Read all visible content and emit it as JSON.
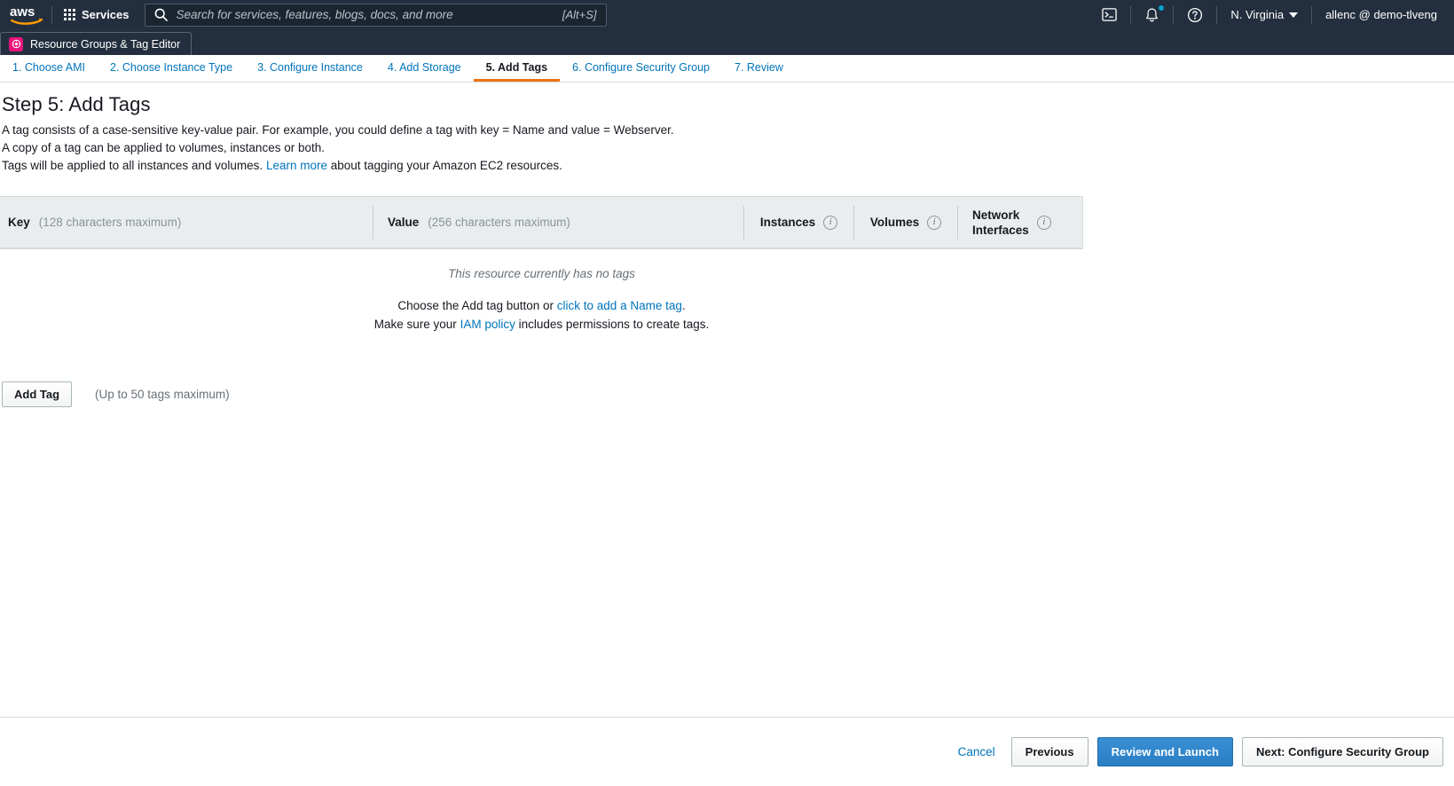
{
  "topbar": {
    "logo_alt": "aws",
    "services_label": "Services",
    "search_placeholder": "Search for services, features, blogs, docs, and more",
    "search_value": "",
    "search_shortcut": "[Alt+S]",
    "cloudshell_icon": "terminal-icon",
    "notifications_icon": "bell-icon",
    "help_icon": "question-circle-icon",
    "region_label": "N. Virginia",
    "account_label": "allenc @ demo-tlveng",
    "colors": {
      "nav_background": "#232f3e",
      "notification_dot": "#00a1c9",
      "resource_group_icon": "#e7157b"
    }
  },
  "secondbar": {
    "resource_groups_label": "Resource Groups & Tag Editor"
  },
  "wizard": {
    "steps": [
      {
        "label": "1. Choose AMI",
        "active": false
      },
      {
        "label": "2. Choose Instance Type",
        "active": false
      },
      {
        "label": "3. Configure Instance",
        "active": false
      },
      {
        "label": "4. Add Storage",
        "active": false
      },
      {
        "label": "5. Add Tags",
        "active": true
      },
      {
        "label": "6. Configure Security Group",
        "active": false
      },
      {
        "label": "7. Review",
        "active": false
      }
    ],
    "active_color": "#ec7211"
  },
  "page": {
    "title": "Step 5: Add Tags",
    "desc_line1": "A tag consists of a case-sensitive key-value pair. For example, you could define a tag with key = Name and value = Webserver.",
    "desc_line2": "A copy of a tag can be applied to volumes, instances or both.",
    "desc_line3_pre": "Tags will be applied to all instances and volumes.",
    "desc_line3_link": "Learn more",
    "desc_line3_post": "about tagging your Amazon EC2 resources."
  },
  "table": {
    "key_label": "Key",
    "key_hint": "(128 characters maximum)",
    "value_label": "Value",
    "value_hint": "(256 characters maximum)",
    "instances_label": "Instances",
    "volumes_label": "Volumes",
    "netif_label_line1": "Network",
    "netif_label_line2": "Interfaces",
    "info_glyph": "i"
  },
  "empty_state": {
    "no_tags_text": "This resource currently has no tags",
    "line1_pre": "Choose the Add tag button or",
    "line1_link": "click to add a Name tag",
    "line1_post": ".",
    "line2_pre": "Make sure your",
    "line2_link": "IAM policy",
    "line2_post": "includes permissions to create tags."
  },
  "actions": {
    "add_tag_label": "Add Tag",
    "add_tag_hint": "(Up to 50 tags maximum)"
  },
  "footer": {
    "cancel_label": "Cancel",
    "previous_label": "Previous",
    "review_launch_label": "Review and Launch",
    "next_label": "Next: Configure Security Group",
    "primary_color": "#2a7fc4"
  }
}
